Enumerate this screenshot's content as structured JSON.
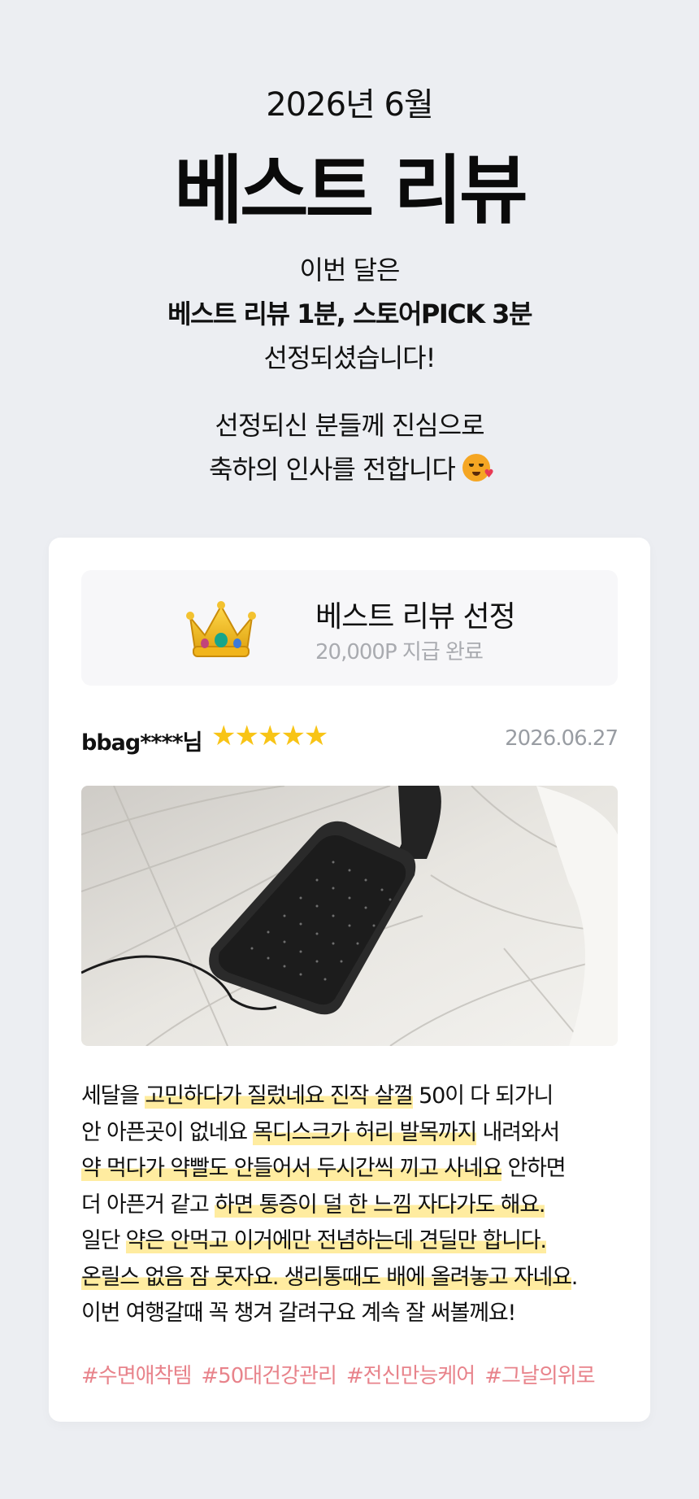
{
  "header": {
    "month": "2026년 6월",
    "title": "베스트 리뷰",
    "line1": "이번 달은",
    "line2": "베스트 리뷰 1분, 스토어PICK 3분",
    "line3": "선정되셨습니다!",
    "line4": "선정되신 분들께 진심으로",
    "line5": "축하의 인사를 전합니다",
    "emoji": "smiling-face-with-hearts-icon"
  },
  "badge": {
    "title": "베스트 리뷰 선정",
    "subtitle": "20,000P 지급 완료",
    "icon": "crown-icon"
  },
  "review": {
    "user": "bbag****님",
    "rating": 5,
    "stars": "★★★★★",
    "date": "2026.06.27",
    "star_color": "#f8c416",
    "lines": [
      [
        {
          "t": "세달을 ",
          "h": false
        },
        {
          "t": "고민하다가 질렀네요 진작 살껄",
          "h": true
        },
        {
          "t": " 50이 다 되가니",
          "h": false
        }
      ],
      [
        {
          "t": "안 아픈곳이 없네요 ",
          "h": false
        },
        {
          "t": "목디스크가 허리 발목까지",
          "h": true
        },
        {
          "t": " 내려와서",
          "h": false
        }
      ],
      [
        {
          "t": "약 먹다가 약빨도 안들어서 두시간씩 끼고 사네요",
          "h": true
        },
        {
          "t": " 안하면",
          "h": false
        }
      ],
      [
        {
          "t": "더 아픈거 같고 ",
          "h": false
        },
        {
          "t": "하면 통증이 덜 한 느낌 자다가도 해요. ",
          "h": true
        }
      ],
      [
        {
          "t": "일단 ",
          "h": false
        },
        {
          "t": "약은 안먹고 이거에만 전념하는데 견딜만 합니다.",
          "h": true
        }
      ],
      [
        {
          "t": "온릴스 없음 잠 못자요. 생리통때도 배에 올려놓고 자네요",
          "h": true
        },
        {
          "t": ".",
          "h": false
        }
      ],
      [
        {
          "t": "이번 여행갈때 꼭 챙겨 갈려구요 계속 잘 써볼께요!",
          "h": false
        }
      ]
    ],
    "tags": [
      "#수면애착템",
      "#50대건강관리",
      "#전신만능케어",
      "#그날의위로"
    ],
    "highlight_color": "#ffeca0",
    "tag_color": "#e8838b"
  }
}
